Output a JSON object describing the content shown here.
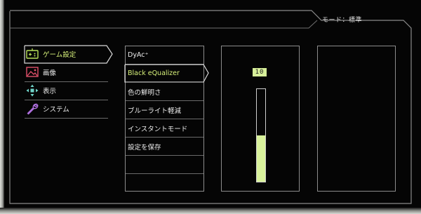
{
  "header": {
    "mode_label": "モード：標準"
  },
  "main_menu": {
    "items": [
      {
        "label": "ゲーム設定",
        "icon": "gamepad-icon",
        "selected": true
      },
      {
        "label": "画像",
        "icon": "picture-icon",
        "selected": false
      },
      {
        "label": "表示",
        "icon": "display-arrows-icon",
        "selected": false
      },
      {
        "label": "システム",
        "icon": "wrench-icon",
        "selected": false
      }
    ]
  },
  "sub_menu": {
    "items": [
      {
        "label": "DyAc⁺",
        "selected": false
      },
      {
        "label": "Black eQualizer",
        "selected": true
      },
      {
        "label": "色の鮮明さ",
        "selected": false
      },
      {
        "label": "ブルーライト軽減",
        "selected": false
      },
      {
        "label": "インスタントモード",
        "selected": false
      },
      {
        "label": "設定を保存",
        "selected": false
      },
      {
        "label": "",
        "selected": false
      },
      {
        "label": "",
        "selected": false
      }
    ]
  },
  "adjust": {
    "value": "10",
    "level_fraction": 0.5
  },
  "colors": {
    "accent": "#d6f07a",
    "slider_fill": "#d9f29c",
    "text": "#eaeaea",
    "divider": "#6a6a6a"
  }
}
